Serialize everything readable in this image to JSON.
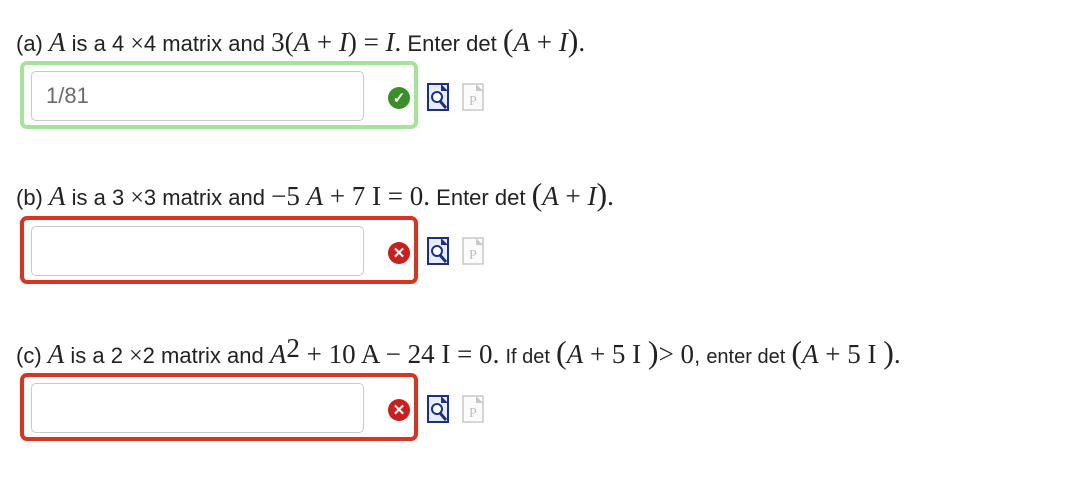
{
  "questions": [
    {
      "label": "(a)",
      "var": "A",
      "t1": "is a 4",
      "times": "×",
      "t2": "4 matrix and",
      "eq_a": "3(",
      "eq_b": "A",
      "eq_c": " + ",
      "eq_d": "I",
      "eq_e": ") = ",
      "eq_f": "I",
      "eq_g": ".",
      "enter": "Enter det",
      "det_open": "(",
      "det_a": "A",
      "det_b": " + ",
      "det_c": "I",
      "det_close": ")",
      "end": ".",
      "answer": "1/81",
      "status": "correct",
      "status_icon": "checkmark-icon"
    },
    {
      "label": "(b)",
      "var": "A",
      "t1": "is a 3",
      "times": "×",
      "t2": "3 matrix and",
      "eq_a": "−5 ",
      "eq_b": "A",
      "eq_c": " + 7 I = 0",
      "end_inline": ".",
      "enter": "Enter det",
      "det_open": "(",
      "det_a": "A",
      "det_b": " + ",
      "det_c": "I",
      "det_close": ")",
      "end": ".",
      "answer": "",
      "status": "incorrect",
      "status_icon": "x-icon"
    },
    {
      "label": "(c)",
      "var": "A",
      "t1": "is a 2",
      "times": "×",
      "t2": "2 matrix and",
      "eq_a": "A",
      "eq_sup": "2",
      "eq_b": " + 10 A − 24 I = 0",
      "end_inline": ".",
      "if_det": "If det",
      "cond_open": "(",
      "cond_a": "A",
      "cond_b": " + 5 I ",
      "cond_close": ")",
      "cond_gt": "> 0",
      "comma": ",",
      "enter": "enter det",
      "det_open": "(",
      "det_a": "A",
      "det_b": " + 5 I ",
      "det_close": ")",
      "end": ".",
      "answer": "",
      "status": "incorrect",
      "status_icon": "x-icon"
    }
  ],
  "tools": {
    "preview_icon": "preview-magnifier-icon",
    "p_icon": "p-document-icon",
    "ok_mark": "✓",
    "bad_mark": "✕"
  }
}
